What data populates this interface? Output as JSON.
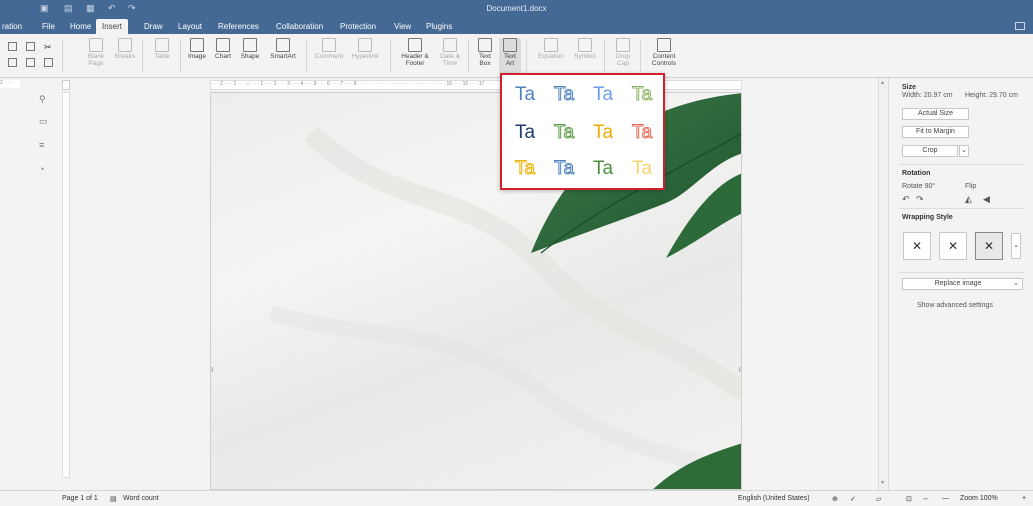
{
  "window": {
    "title": "Document1.docx"
  },
  "tabs": [
    {
      "label": "ration"
    },
    {
      "label": "File"
    },
    {
      "label": "Home"
    },
    {
      "label": "Insert"
    },
    {
      "label": "Draw"
    },
    {
      "label": "Layout"
    },
    {
      "label": "References"
    },
    {
      "label": "Collaboration"
    },
    {
      "label": "Protection"
    },
    {
      "label": "View"
    },
    {
      "label": "Plugins"
    }
  ],
  "ribbon": {
    "blank_page": "Blank\nPage",
    "breaks": "Breaks",
    "table": "Table",
    "image": "Image",
    "chart": "Chart",
    "shape": "Shape",
    "smartart": "SmartArt",
    "comment": "Comment",
    "hyperlink": "Hyperlink",
    "header_footer": "Header &\nFooter",
    "date_time": "Date &\nTime",
    "text_box": "Text\nBox",
    "text_art": "Text\nArt",
    "equation": "Equation",
    "symbol": "Symbol",
    "drop_cap": "Drop\nCap",
    "content_controls": "Content\nControls"
  },
  "textart_styles": [
    {
      "label": "Ta",
      "fill": "#4f81bd",
      "stroke": "none"
    },
    {
      "label": "Ta",
      "fill": "#ffffff",
      "stroke": "#4f81bd"
    },
    {
      "label": "Ta",
      "fill": "#6d9eeb",
      "stroke": "none"
    },
    {
      "label": "Ta",
      "fill": "#ffffff",
      "stroke": "#8db56a"
    },
    {
      "label": "Ta",
      "fill": "#1f3a6e",
      "stroke": "none"
    },
    {
      "label": "Ta",
      "fill": "#ffffff",
      "stroke": "#5b9a47"
    },
    {
      "label": "Ta",
      "fill": "#f2a900",
      "stroke": "none"
    },
    {
      "label": "Ta",
      "fill": "#ffffff",
      "stroke": "#e26d5a"
    },
    {
      "label": "Ta",
      "fill": "#ffffff",
      "stroke": "#f0b000"
    },
    {
      "label": "Ta",
      "fill": "#ffffff",
      "stroke": "#4a7ebb"
    },
    {
      "label": "Ta",
      "fill": "#4e8f3f",
      "stroke": "none"
    },
    {
      "label": "Ta",
      "fill": "#fad36b",
      "stroke": "none"
    }
  ],
  "ruler": {
    "text": "· · · 2 · · · 1 · · · ⌂ · · · 1 · · · 2 · · · 3 · · · 4 · · · 5 · · · 6 · · · 7 · · · 8 · · · · · · · · · · · · · · · · · · · · · · · · · · · · · 15 · · · 16 · · · 17 · · ·"
  },
  "ruler_left": "2 · · ·",
  "right_panel": {
    "size_heading": "Size",
    "width_label": "Width: 20.97 cm",
    "height_label": "Height: 29.70 cm",
    "actual_size": "Actual Size",
    "fit_to_margin": "Fit to Margin",
    "crop": "Crop",
    "rotation_heading": "Rotation",
    "rotate_label": "Rotate 90°",
    "flip_label": "Flip",
    "wrapping_heading": "Wrapping Style",
    "replace_image": "Replace image",
    "advanced": "Show advanced settings"
  },
  "status": {
    "page": "Page 1 of 1",
    "word_count": "Word count",
    "language": "English (United States)",
    "zoom": "Zoom 100%"
  },
  "colors": {
    "titlebar": "#446995",
    "popup_border": "#d0202e",
    "leaf": "#2f6b3a"
  }
}
